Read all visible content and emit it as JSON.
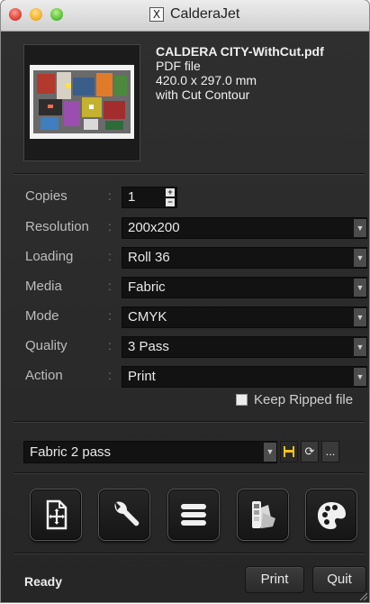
{
  "window": {
    "title": "CalderaJet",
    "title_icon": "X"
  },
  "file": {
    "name": "CALDERA CITY-WithCut.pdf",
    "type": "PDF file",
    "size": "420.0 x 297.0 mm",
    "note": "with Cut Contour"
  },
  "settings": {
    "copies_label": "Copies",
    "copies_value": "1",
    "rows": [
      {
        "label": "Resolution",
        "value": "200x200"
      },
      {
        "label": "Loading",
        "value": "Roll 36"
      },
      {
        "label": "Media",
        "value": "Fabric"
      },
      {
        "label": "Mode",
        "value": "CMYK"
      },
      {
        "label": "Quality",
        "value": "3 Pass"
      },
      {
        "label": "Action",
        "value": "Print"
      }
    ],
    "separator": ":",
    "keep_ripped_label": "Keep Ripped file",
    "keep_ripped_checked": false
  },
  "preset": {
    "value": "Fabric 2 pass",
    "more_label": "..."
  },
  "toolbar_icons": [
    "add-file-icon",
    "wrench-icon",
    "list-icon",
    "swatch-icon",
    "palette-icon"
  ],
  "footer": {
    "status": "Ready",
    "print_label": "Print",
    "quit_label": "Quit"
  },
  "colors": {
    "background": "#2b2b2b",
    "field": "#121212",
    "accent_save": "#f2c21b"
  }
}
